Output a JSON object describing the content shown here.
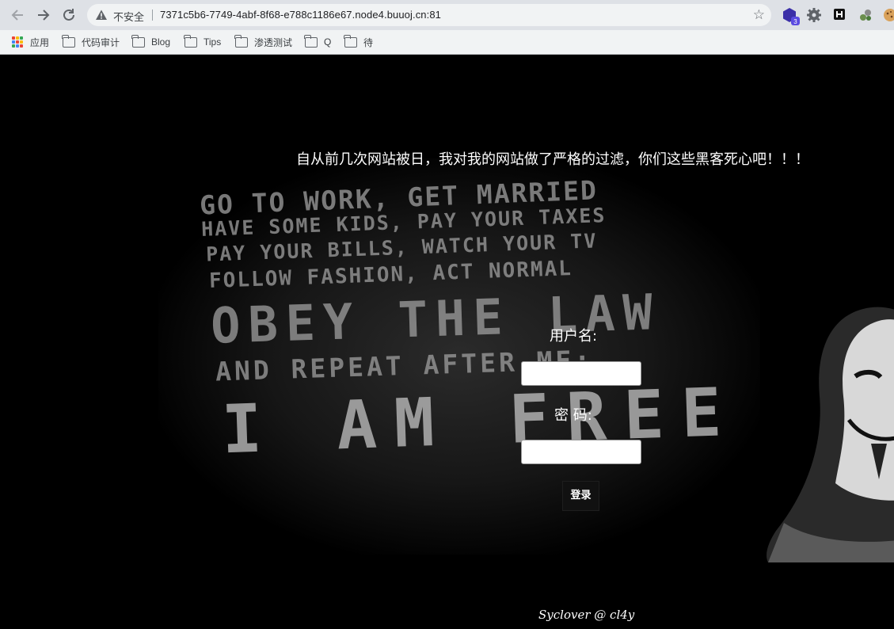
{
  "browser": {
    "url": "7371c5b6-7749-4abf-8f68-e788c1186e67.node4.buuoj.cn:81",
    "security_label": "不安全",
    "extension_badge": "3"
  },
  "bookmarks": [
    {
      "label": "应用",
      "icon": "apps-icon"
    },
    {
      "label": "代码审计",
      "icon": "folder-icon"
    },
    {
      "label": "Blog",
      "icon": "folder-icon"
    },
    {
      "label": "Tips",
      "icon": "folder-icon"
    },
    {
      "label": "渗透测试",
      "icon": "folder-icon"
    },
    {
      "label": "Q",
      "icon": "folder-icon"
    },
    {
      "label": "待",
      "icon": "folder-icon"
    }
  ],
  "page": {
    "headline": "自从前几次网站被日，我对我的网站做了严格的过滤，你们这些黑客死心吧！！！",
    "background_text": [
      "GO TO WORK, GET MARRIED",
      "HAVE SOME KIDS, PAY YOUR TAXES",
      "PAY YOUR BILLS, WATCH YOUR TV",
      "FOLLOW FASHION, ACT NORMAL",
      "OBEY THE LAW",
      "AND REPEAT AFTER ME:",
      "I AM FREE"
    ],
    "form": {
      "username_label": "用户名:",
      "username_value": "",
      "password_label": "密 码:",
      "password_value": "",
      "submit_label": "登录"
    },
    "footer": "Syclover @ cl4y"
  }
}
